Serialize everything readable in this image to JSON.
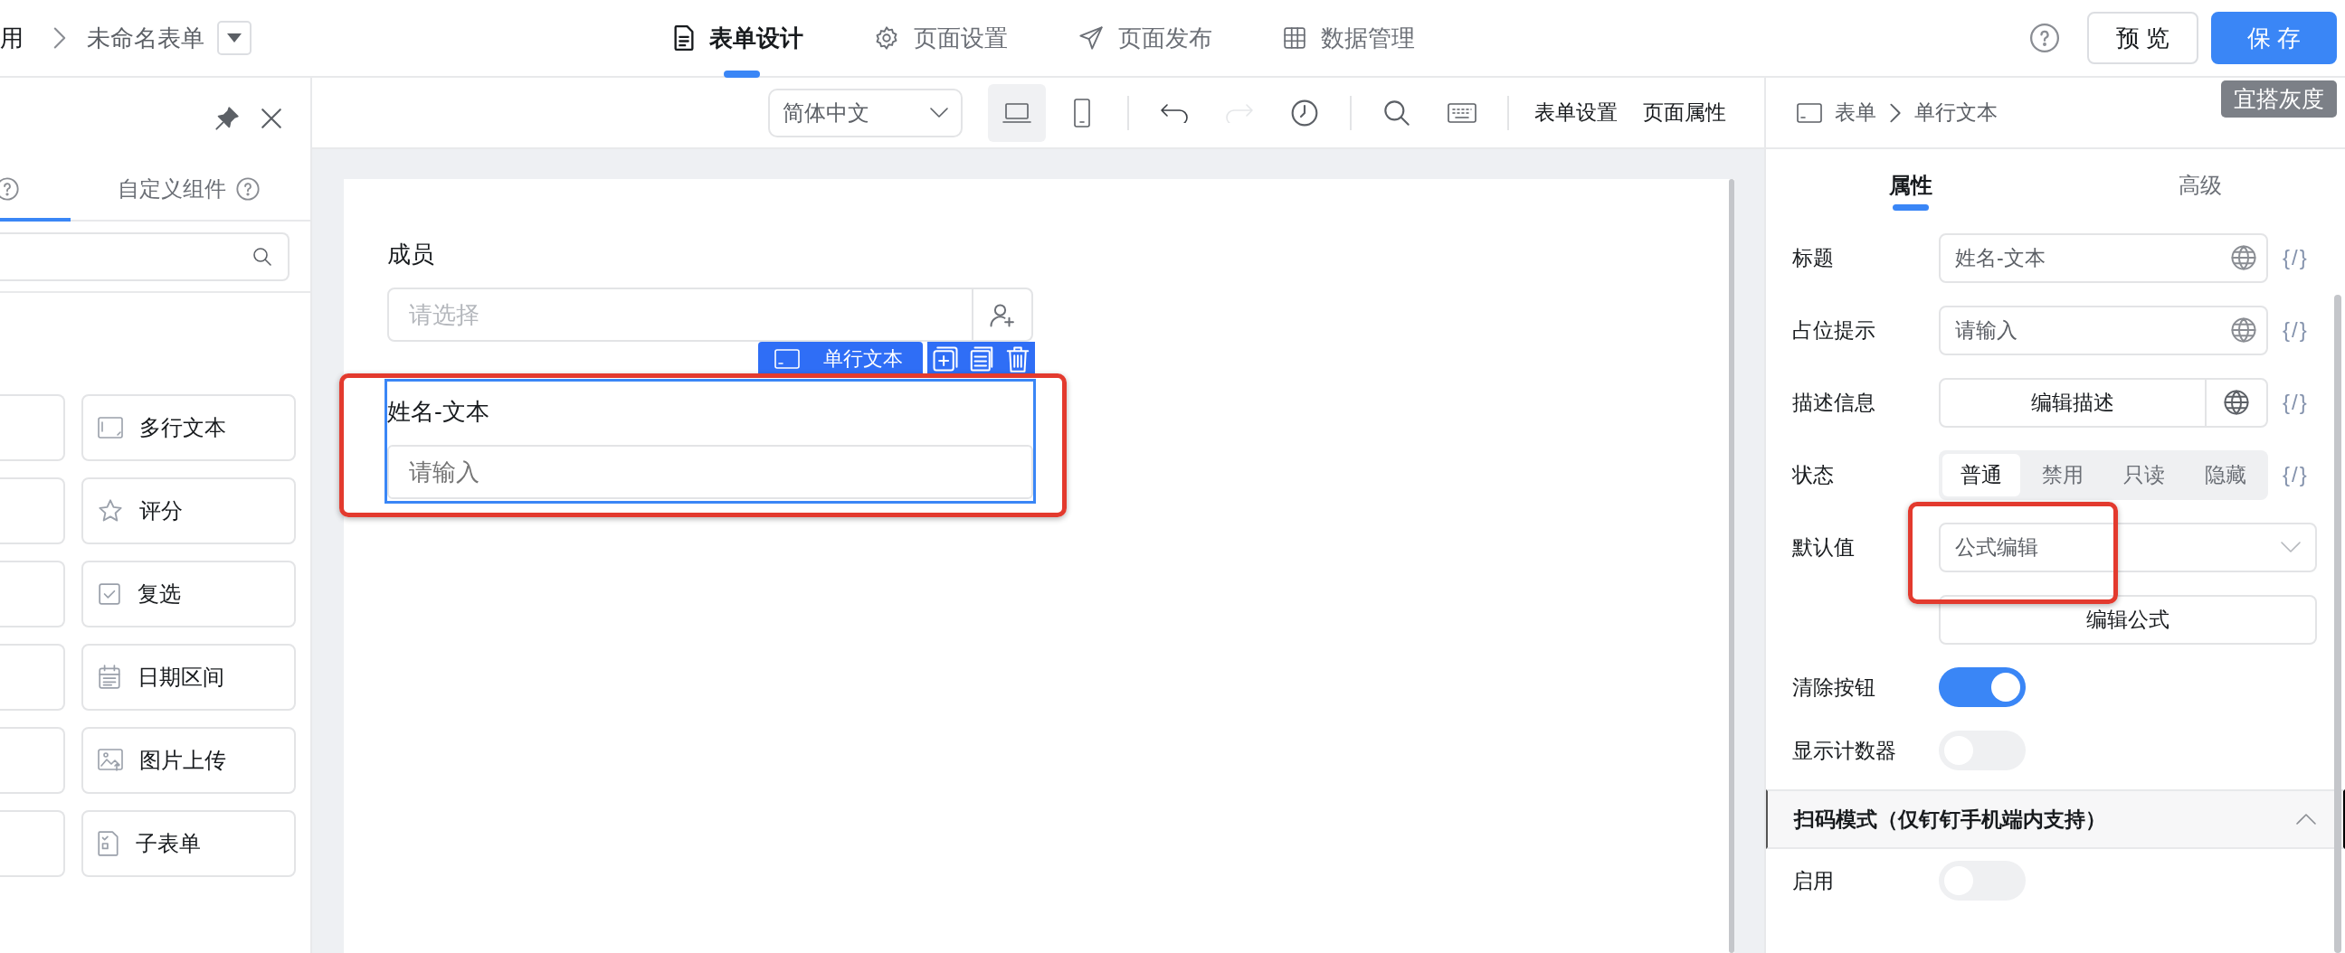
{
  "app_breadcrumb": {
    "app": "用",
    "form": "未命名表单"
  },
  "top_tabs": [
    {
      "label": "表单设计",
      "selected": true
    },
    {
      "label": "页面设置",
      "selected": false
    },
    {
      "label": "页面发布",
      "selected": false
    },
    {
      "label": "数据管理",
      "selected": false
    }
  ],
  "actions": {
    "preview": "预 览",
    "save": "保 存",
    "tooltip": "宜搭灰度"
  },
  "left_panel": {
    "tabs": [
      {
        "selected": true
      },
      {
        "label": "自定义组件",
        "selected": false
      }
    ],
    "components": [
      {
        "label": "多行文本",
        "kind": "textarea"
      },
      {
        "label": "评分",
        "kind": "rating"
      },
      {
        "label": "复选",
        "kind": "checkbox"
      },
      {
        "label": "日期区间",
        "kind": "daterange"
      },
      {
        "label": "图片上传",
        "kind": "image"
      },
      {
        "label": "子表单",
        "kind": "subform"
      }
    ]
  },
  "canvas_toolbar": {
    "language": "简体中文",
    "devices": [
      {
        "kind": "desktop",
        "selected": true
      },
      {
        "kind": "mobile",
        "selected": false
      }
    ],
    "history": [
      {
        "kind": "undo",
        "disabled": false
      },
      {
        "kind": "redo",
        "disabled": true
      }
    ],
    "links": [
      "表单设置",
      "页面属性"
    ]
  },
  "form": {
    "fields": [
      {
        "kind": "member",
        "label": "成员",
        "placeholder": "请选择",
        "selected": false
      },
      {
        "kind": "text",
        "label": "姓名-文本",
        "placeholder": "请输入",
        "selected": true,
        "type_tag": "单行文本"
      }
    ]
  },
  "properties": {
    "breadcrumb": [
      "表单",
      "单行文本"
    ],
    "tabs": [
      {
        "label": "属性",
        "selected": true
      },
      {
        "label": "高级",
        "selected": false
      }
    ],
    "rows": [
      {
        "kind": "input",
        "label": "标题",
        "value": "姓名-文本",
        "binding": "{/}"
      },
      {
        "kind": "input",
        "label": "占位提示",
        "value": "请输入",
        "binding": "{/}"
      },
      {
        "kind": "button",
        "label": "描述信息",
        "button": "编辑描述",
        "binding": "{/}"
      },
      {
        "kind": "segmented",
        "label": "状态",
        "binding": "{/}",
        "options": [
          {
            "label": "普通",
            "selected": true
          },
          {
            "label": "禁用",
            "selected": false
          },
          {
            "label": "只读",
            "selected": false
          },
          {
            "label": "隐藏",
            "selected": false
          }
        ]
      },
      {
        "kind": "select",
        "label": "默认值",
        "value": "公式编辑"
      },
      {
        "kind": "wide-button",
        "button": "编辑公式"
      },
      {
        "kind": "switch",
        "label": "清除按钮",
        "on": true
      },
      {
        "kind": "switch",
        "label": "显示计数器",
        "on": false
      },
      {
        "kind": "section",
        "label": "扫码模式（仅钉钉手机端内支持）",
        "expanded": true
      },
      {
        "kind": "switch",
        "label": "启用",
        "on": false
      }
    ]
  },
  "highlights": {
    "canvas": true,
    "properties": true
  }
}
